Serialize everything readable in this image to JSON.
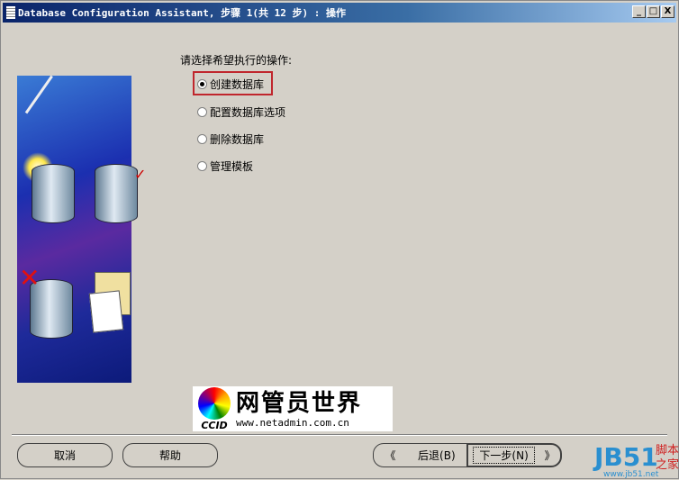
{
  "window": {
    "title": "Database Configuration Assistant, 步骤 1(共 12 步) : 操作",
    "min": "_",
    "max": "□",
    "close": "X"
  },
  "main": {
    "prompt": "请选择希望执行的操作:",
    "options": [
      {
        "label": "创建数据库",
        "selected": true
      },
      {
        "label": "配置数据库选项",
        "selected": false
      },
      {
        "label": "删除数据库",
        "selected": false
      },
      {
        "label": "管理模板",
        "selected": false
      }
    ]
  },
  "logo": {
    "title": "网管员世界",
    "brand": "CCID",
    "url": "www.netadmin.com.cn"
  },
  "buttons": {
    "cancel": "取消",
    "help": "帮助",
    "back": "后退(B)",
    "next": "下一步(N)",
    "back_arrow": "《",
    "next_arrow": "》"
  },
  "watermark": {
    "logo": "JB51",
    "text1": "脚本",
    "text2": "之家",
    "url": "www.jb51.net"
  }
}
